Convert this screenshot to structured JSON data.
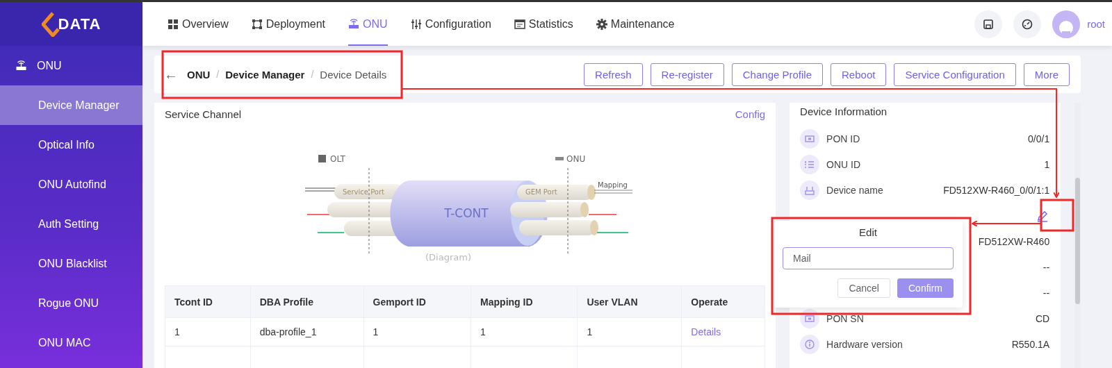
{
  "logo": {
    "text": "DATA"
  },
  "nav_tabs": [
    {
      "label": "Overview",
      "selected": false
    },
    {
      "label": "Deployment",
      "selected": false
    },
    {
      "label": "ONU",
      "selected": true
    },
    {
      "label": "Configuration",
      "selected": false
    },
    {
      "label": "Statistics",
      "selected": false
    },
    {
      "label": "Maintenance",
      "selected": false
    }
  ],
  "user": {
    "name": "root"
  },
  "sidebar": {
    "group": "ONU",
    "items": [
      {
        "label": "Device Manager",
        "selected": true
      },
      {
        "label": "Optical Info",
        "selected": false
      },
      {
        "label": "ONU Autofind",
        "selected": false
      },
      {
        "label": "Auth Setting",
        "selected": false
      },
      {
        "label": "ONU Blacklist",
        "selected": false
      },
      {
        "label": "Rogue ONU",
        "selected": false
      },
      {
        "label": "ONU MAC",
        "selected": false
      }
    ]
  },
  "breadcrumb": {
    "back": "←",
    "separator": "/",
    "items": [
      "ONU",
      "Device Manager",
      "Device Details"
    ]
  },
  "actions": [
    "Refresh",
    "Re-register",
    "Change Profile",
    "Reboot",
    "Service Configuration",
    "More"
  ],
  "service_channel": {
    "title": "Service Channel",
    "link": "Config",
    "diagram": {
      "olt": "OLT",
      "onu": "ONU",
      "service_port": "Service Port",
      "gem_port": "GEM Port",
      "mapping": "Mapping",
      "tcont": "T-CONT",
      "caption": "(Diagram)"
    }
  },
  "table": {
    "columns": [
      "Tcont ID",
      "DBA Profile",
      "Gemport ID",
      "Mapping ID",
      "User VLAN",
      "Operate"
    ],
    "rows": [
      [
        "1",
        "dba-profile_1",
        "1",
        "1",
        "1",
        "Details"
      ]
    ]
  },
  "device_info": {
    "title": "Device Information",
    "rows": [
      {
        "kind": "field",
        "label": "PON ID",
        "value": "0/0/1"
      },
      {
        "kind": "field",
        "label": "ONU ID",
        "value": "1"
      },
      {
        "kind": "field",
        "label": "Device name",
        "value": "FD512XW-R460_0/0/1:1"
      },
      {
        "kind": "editable"
      },
      {
        "kind": "field",
        "value": "FD512XW-R460"
      },
      {
        "kind": "field",
        "value": "--"
      },
      {
        "kind": "field",
        "value": "--"
      },
      {
        "kind": "field",
        "label": "PON SN",
        "value": "CD"
      },
      {
        "kind": "field",
        "label": "Hardware version",
        "value": "R550.1A"
      }
    ]
  },
  "edit_popover": {
    "title": "Edit",
    "value": "Mail",
    "cancel": "Cancel",
    "confirm": "Confirm"
  }
}
